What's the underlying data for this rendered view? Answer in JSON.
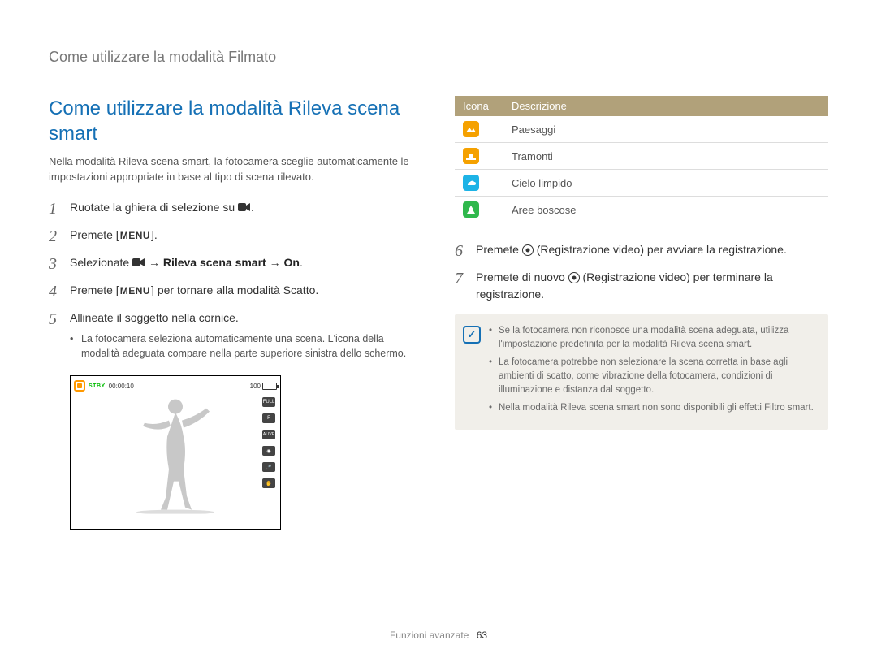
{
  "header": "Come utilizzare la modalità Filmato",
  "title": "Come utilizzare la modalità Rileva scena smart",
  "intro": "Nella modalità Rileva scena smart, la fotocamera sceglie automaticamente le impostazioni appropriate in base al tipo di scena rilevato.",
  "steps_left": {
    "s1": "Ruotate la ghiera di selezione su ",
    "s2_a": "Premete [",
    "s2_b": "].",
    "s3_a": "Selezionate ",
    "s3_b": "Rileva scena smart",
    "s3_c": "On",
    "s4_a": "Premete [",
    "s4_b": "] per tornare alla modalità Scatto.",
    "s5": "Allineate il soggetto nella cornice.",
    "s5_sub": "La fotocamera seleziona automaticamente una scena. L'icona della modalità adeguata compare nella parte superiore sinistra dello schermo."
  },
  "preview": {
    "stby": "STBY",
    "time": "00:00:10",
    "batt": "100"
  },
  "table": {
    "h1": "Icona",
    "h2": "Descrizione",
    "rows": [
      {
        "desc": "Paesaggi",
        "color": "#f5a100"
      },
      {
        "desc": "Tramonti",
        "color": "#f5a100"
      },
      {
        "desc": "Cielo limpido",
        "color": "#1db3e6"
      },
      {
        "desc": "Aree boscose",
        "color": "#2fb84c"
      }
    ]
  },
  "steps_right": {
    "s6_a": "Premete ",
    "s6_b": " (Registrazione video) per avviare la registrazione.",
    "s7_a": "Premete di nuovo ",
    "s7_b": " (Registrazione video) per terminare la registrazione."
  },
  "notes": [
    "Se la fotocamera non riconosce una modalità scena adeguata, utilizza l'impostazione predefinita per la modalità Rileva scena smart.",
    "La fotocamera potrebbe non selezionare la scena corretta in base agli ambienti di scatto, come vibrazione della fotocamera, condizioni di illuminazione e distanza dal soggetto.",
    "Nella modalità Rileva scena smart non sono disponibili gli effetti Filtro smart."
  ],
  "footer": {
    "section": "Funzioni avanzate",
    "page": "63"
  },
  "menu_label": "MENU"
}
